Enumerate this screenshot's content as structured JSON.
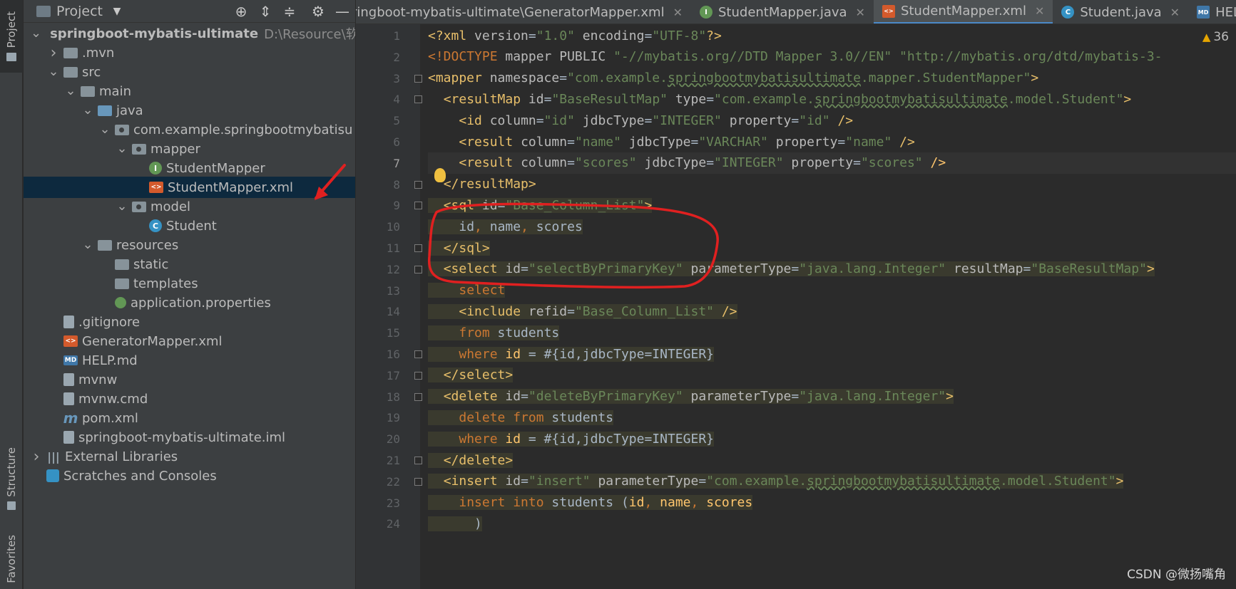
{
  "left_strip": {
    "project": "Project",
    "structure": "Structure",
    "favorites": "Favorites"
  },
  "panel": {
    "title": "Project",
    "icons": [
      "locate-icon",
      "expand-all-icon",
      "collapse-all-icon",
      "gear-icon",
      "minimize-icon"
    ],
    "tree": [
      {
        "label": "springboot-mybatis-ultimate",
        "path": "D:\\Resource\\软",
        "icon": "module-folder",
        "depth": 0,
        "arrow": "open",
        "bold": true
      },
      {
        "label": ".mvn",
        "icon": "folder",
        "depth": 1,
        "arrow": "closed"
      },
      {
        "label": "src",
        "icon": "folder",
        "depth": 1,
        "arrow": "open"
      },
      {
        "label": "main",
        "icon": "folder",
        "depth": 2,
        "arrow": "open"
      },
      {
        "label": "java",
        "icon": "source-folder",
        "depth": 3,
        "arrow": "open"
      },
      {
        "label": "com.example.springbootmybatisu",
        "icon": "package",
        "depth": 4,
        "arrow": "open"
      },
      {
        "label": "mapper",
        "icon": "package",
        "depth": 5,
        "arrow": "open"
      },
      {
        "label": "StudentMapper",
        "icon": "interface",
        "depth": 6,
        "arrow": "none"
      },
      {
        "label": "StudentMapper.xml",
        "icon": "xml-file",
        "depth": 6,
        "arrow": "none",
        "selected": true
      },
      {
        "label": "model",
        "icon": "package",
        "depth": 5,
        "arrow": "open"
      },
      {
        "label": "Student",
        "icon": "class",
        "depth": 6,
        "arrow": "none"
      },
      {
        "label": "resources",
        "icon": "resources-folder",
        "depth": 3,
        "arrow": "open"
      },
      {
        "label": "static",
        "icon": "folder",
        "depth": 4,
        "arrow": "none"
      },
      {
        "label": "templates",
        "icon": "folder",
        "depth": 4,
        "arrow": "none"
      },
      {
        "label": "application.properties",
        "icon": "properties-file",
        "depth": 4,
        "arrow": "none"
      },
      {
        "label": ".gitignore",
        "icon": "file",
        "depth": 1,
        "arrow": "none"
      },
      {
        "label": "GeneratorMapper.xml",
        "icon": "xml-file",
        "depth": 1,
        "arrow": "none"
      },
      {
        "label": "HELP.md",
        "icon": "md-file",
        "depth": 1,
        "arrow": "none"
      },
      {
        "label": "mvnw",
        "icon": "file",
        "depth": 1,
        "arrow": "none"
      },
      {
        "label": "mvnw.cmd",
        "icon": "file",
        "depth": 1,
        "arrow": "none"
      },
      {
        "label": "pom.xml",
        "icon": "maven-file",
        "depth": 1,
        "arrow": "none"
      },
      {
        "label": "springboot-mybatis-ultimate.iml",
        "icon": "file",
        "depth": 1,
        "arrow": "none"
      },
      {
        "label": "External Libraries",
        "icon": "libraries",
        "depth": 0,
        "arrow": "closed"
      },
      {
        "label": "Scratches and Consoles",
        "icon": "scratches",
        "depth": 0,
        "arrow": "none"
      }
    ]
  },
  "tabs": [
    {
      "label": "ringboot-mybatis-ultimate\\GeneratorMapper.xml",
      "icon": "none",
      "active": false
    },
    {
      "label": "StudentMapper.java",
      "icon": "interface",
      "active": false
    },
    {
      "label": "StudentMapper.xml",
      "icon": "xml",
      "active": true
    },
    {
      "label": "Student.java",
      "icon": "class",
      "active": false
    },
    {
      "label": "HELP",
      "icon": "md",
      "active": false
    }
  ],
  "editor": {
    "warnings": "36",
    "current_line": 7,
    "lines": [
      {
        "n": 1,
        "tokens": [
          [
            "dec",
            "<?xml "
          ],
          [
            "attr",
            "version"
          ],
          [
            "pl",
            "="
          ],
          [
            "val",
            "\"1.0\" "
          ],
          [
            "attr",
            "encoding"
          ],
          [
            "pl",
            "="
          ],
          [
            "val",
            "\"UTF-8\""
          ],
          [
            "dec",
            "?>"
          ]
        ]
      },
      {
        "n": 2,
        "tokens": [
          [
            "doc",
            "<!DOCTYPE "
          ],
          [
            "attr",
            "mapper PUBLIC "
          ],
          [
            "val",
            "\"-//mybatis.org//DTD Mapper 3.0//EN\" \"http://mybatis.org/dtd/mybatis-3-"
          ]
        ]
      },
      {
        "n": 3,
        "tokens": [
          [
            "tag",
            "<mapper "
          ],
          [
            "attr",
            "namespace"
          ],
          [
            "pl",
            "="
          ],
          [
            "val",
            "\"com.example."
          ],
          [
            "valu",
            "springbootmybatisultimate"
          ],
          [
            "val",
            ".mapper.StudentMapper\""
          ],
          [
            "tag",
            ">"
          ]
        ]
      },
      {
        "n": 4,
        "tokens": [
          [
            "sp",
            "  "
          ],
          [
            "tag",
            "<resultMap "
          ],
          [
            "attr",
            "id"
          ],
          [
            "pl",
            "="
          ],
          [
            "val",
            "\"BaseResultMap\" "
          ],
          [
            "attr",
            "type"
          ],
          [
            "pl",
            "="
          ],
          [
            "val",
            "\"com.example."
          ],
          [
            "valu",
            "springbootmybatisultimate"
          ],
          [
            "val",
            ".model.Student\""
          ],
          [
            "tag",
            ">"
          ]
        ]
      },
      {
        "n": 5,
        "tokens": [
          [
            "sp",
            "    "
          ],
          [
            "tag",
            "<id "
          ],
          [
            "attr",
            "column"
          ],
          [
            "pl",
            "="
          ],
          [
            "val",
            "\"id\" "
          ],
          [
            "attr",
            "jdbcType"
          ],
          [
            "pl",
            "="
          ],
          [
            "val",
            "\"INTEGER\" "
          ],
          [
            "attr",
            "property"
          ],
          [
            "pl",
            "="
          ],
          [
            "val",
            "\"id\" "
          ],
          [
            "tag",
            "/>"
          ]
        ]
      },
      {
        "n": 6,
        "tokens": [
          [
            "sp",
            "    "
          ],
          [
            "tag",
            "<result "
          ],
          [
            "attr",
            "column"
          ],
          [
            "pl",
            "="
          ],
          [
            "val",
            "\"name\" "
          ],
          [
            "attr",
            "jdbcType"
          ],
          [
            "pl",
            "="
          ],
          [
            "val",
            "\"VARCHAR\" "
          ],
          [
            "attr",
            "property"
          ],
          [
            "pl",
            "="
          ],
          [
            "val",
            "\"name\" "
          ],
          [
            "tag",
            "/>"
          ]
        ]
      },
      {
        "n": 7,
        "tokens": [
          [
            "sp",
            "    "
          ],
          [
            "tag",
            "<result "
          ],
          [
            "attr",
            "column"
          ],
          [
            "pl",
            "="
          ],
          [
            "val",
            "\"scores\" "
          ],
          [
            "attr",
            "jdbcType"
          ],
          [
            "pl",
            "="
          ],
          [
            "val",
            "\"INTEGER\" "
          ],
          [
            "attr",
            "property"
          ],
          [
            "pl",
            "="
          ],
          [
            "val",
            "\"scores\" "
          ],
          [
            "bright",
            "/>"
          ]
        ]
      },
      {
        "n": 8,
        "tokens": [
          [
            "sp",
            "  "
          ],
          [
            "tag",
            "</resultMap>"
          ]
        ]
      },
      {
        "n": 9,
        "hl": true,
        "tokens": [
          [
            "sp",
            "  "
          ],
          [
            "tag",
            "<sql "
          ],
          [
            "attr",
            "id"
          ],
          [
            "pl",
            "="
          ],
          [
            "val",
            "\"Base_Column_List\""
          ],
          [
            "tag",
            ">"
          ]
        ]
      },
      {
        "n": 10,
        "hl": true,
        "tokens": [
          [
            "sp",
            "    "
          ],
          [
            "pl",
            "id"
          ],
          [
            "kw",
            ", "
          ],
          [
            "pl",
            "name"
          ],
          [
            "kw",
            ", "
          ],
          [
            "pl",
            "scores"
          ]
        ]
      },
      {
        "n": 11,
        "hl": true,
        "tokens": [
          [
            "sp",
            "  "
          ],
          [
            "tag",
            "</sql>"
          ]
        ]
      },
      {
        "n": 12,
        "hl": true,
        "tokens": [
          [
            "sp",
            "  "
          ],
          [
            "tag",
            "<select "
          ],
          [
            "attr",
            "id"
          ],
          [
            "pl",
            "="
          ],
          [
            "val",
            "\"selectByPrimaryKey\" "
          ],
          [
            "attr",
            "parameterType"
          ],
          [
            "pl",
            "="
          ],
          [
            "val",
            "\"java.lang.Integer\" "
          ],
          [
            "attr",
            "resultMap"
          ],
          [
            "pl",
            "="
          ],
          [
            "val",
            "\"BaseResultMap\""
          ],
          [
            "tag",
            ">"
          ]
        ]
      },
      {
        "n": 13,
        "hl": true,
        "tokens": [
          [
            "sp",
            "    "
          ],
          [
            "kw",
            "select"
          ]
        ]
      },
      {
        "n": 14,
        "hl": true,
        "tokens": [
          [
            "sp",
            "    "
          ],
          [
            "tag",
            "<include "
          ],
          [
            "attr",
            "refid"
          ],
          [
            "pl",
            "="
          ],
          [
            "val",
            "\"Base_Column_List\" "
          ],
          [
            "tag",
            "/>"
          ]
        ]
      },
      {
        "n": 15,
        "hl": true,
        "tokens": [
          [
            "sp",
            "    "
          ],
          [
            "kw",
            "from "
          ],
          [
            "pl",
            "students"
          ]
        ]
      },
      {
        "n": 16,
        "hl": true,
        "tokens": [
          [
            "sp",
            "    "
          ],
          [
            "kw",
            "where "
          ],
          [
            "bright",
            "id "
          ],
          [
            "pl",
            "= #{id,jdbcType=INTEGER}"
          ]
        ]
      },
      {
        "n": 17,
        "hl": true,
        "tokens": [
          [
            "sp",
            "  "
          ],
          [
            "tag",
            "</select>"
          ]
        ]
      },
      {
        "n": 18,
        "hl": true,
        "tokens": [
          [
            "sp",
            "  "
          ],
          [
            "tag",
            "<delete "
          ],
          [
            "attr",
            "id"
          ],
          [
            "pl",
            "="
          ],
          [
            "val",
            "\"deleteByPrimaryKey\" "
          ],
          [
            "attr",
            "parameterType"
          ],
          [
            "pl",
            "="
          ],
          [
            "val",
            "\"java.lang.Integer\""
          ],
          [
            "tag",
            ">"
          ]
        ]
      },
      {
        "n": 19,
        "hl": true,
        "tokens": [
          [
            "sp",
            "    "
          ],
          [
            "kw",
            "delete from "
          ],
          [
            "pl",
            "students"
          ]
        ]
      },
      {
        "n": 20,
        "hl": true,
        "tokens": [
          [
            "sp",
            "    "
          ],
          [
            "kw",
            "where "
          ],
          [
            "bright",
            "id "
          ],
          [
            "pl",
            "= #{id,jdbcType=INTEGER}"
          ]
        ]
      },
      {
        "n": 21,
        "hl": true,
        "tokens": [
          [
            "sp",
            "  "
          ],
          [
            "tag",
            "</delete>"
          ]
        ]
      },
      {
        "n": 22,
        "hl": true,
        "tokens": [
          [
            "sp",
            "  "
          ],
          [
            "tag",
            "<insert "
          ],
          [
            "attr",
            "id"
          ],
          [
            "pl",
            "="
          ],
          [
            "val",
            "\"insert\" "
          ],
          [
            "attr",
            "parameterType"
          ],
          [
            "pl",
            "="
          ],
          [
            "val",
            "\"com.example."
          ],
          [
            "valu",
            "springbootmybatisultimate"
          ],
          [
            "val",
            ".model.Student\""
          ],
          [
            "tag",
            ">"
          ]
        ]
      },
      {
        "n": 23,
        "hl": true,
        "tokens": [
          [
            "sp",
            "    "
          ],
          [
            "kw",
            "insert into "
          ],
          [
            "pl",
            "students ("
          ],
          [
            "bright",
            "id"
          ],
          [
            "kw",
            ", "
          ],
          [
            "bright",
            "name"
          ],
          [
            "kw",
            ", "
          ],
          [
            "bright",
            "scores"
          ]
        ]
      },
      {
        "n": 24,
        "hl": true,
        "tokens": [
          [
            "sp",
            "      "
          ],
          [
            "pl",
            ")"
          ]
        ]
      }
    ]
  },
  "watermark": "CSDN @微扬嘴角",
  "colors": {
    "annotation": "#e02020",
    "selection": "#0d293e",
    "accent": "#4a88c7"
  }
}
